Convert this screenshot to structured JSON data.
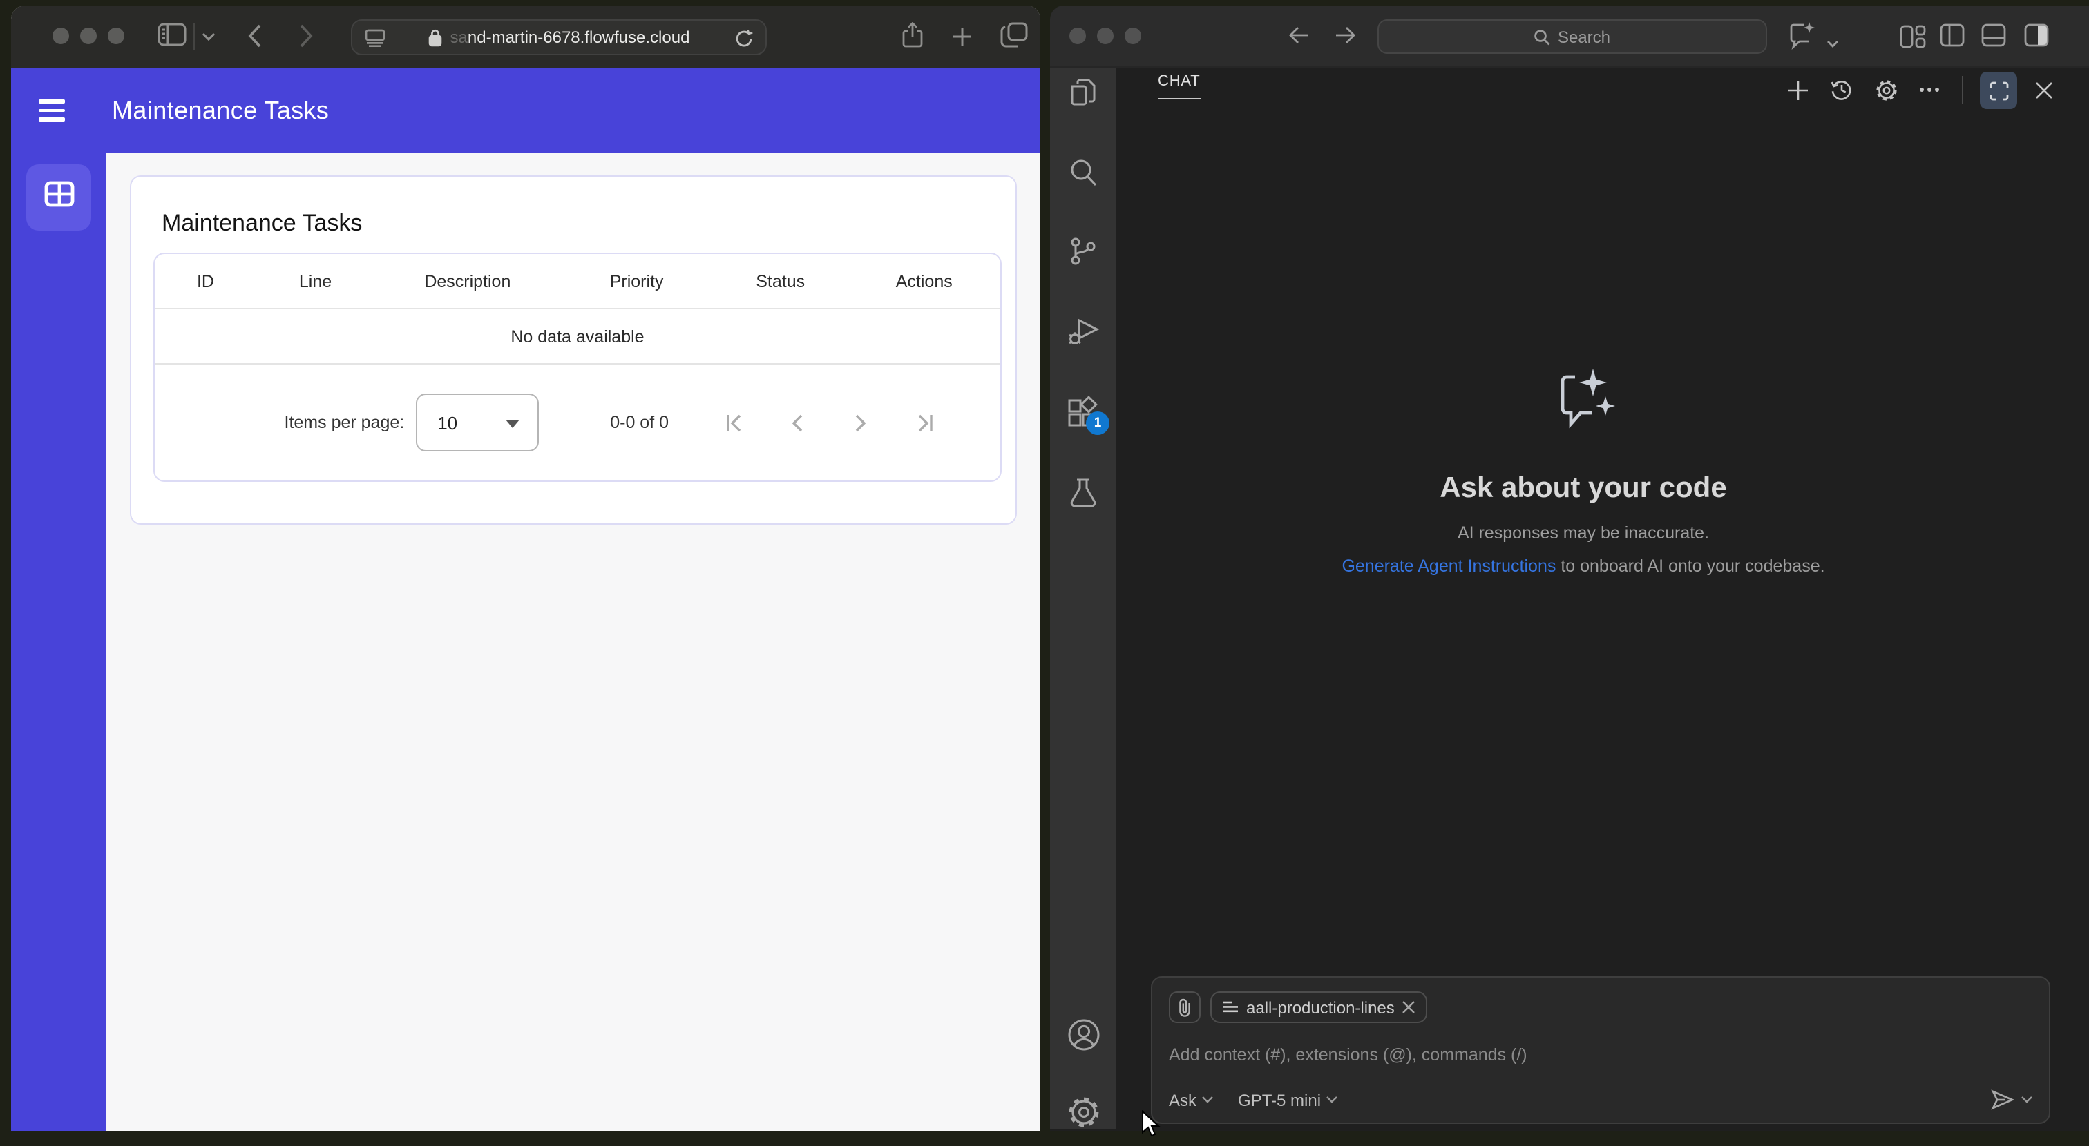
{
  "browser": {
    "url_prefix": "sa",
    "url": "nd-martin-6678.flowfuse.cloud"
  },
  "page": {
    "header_title": "Maintenance Tasks",
    "card_title": "Maintenance Tasks",
    "table": {
      "columns": [
        "ID",
        "Line",
        "Description",
        "Priority",
        "Status",
        "Actions"
      ],
      "empty_message": "No data available"
    },
    "pagination": {
      "items_per_page_label": "Items per page:",
      "items_per_page_value": "10",
      "range_label": "0-0 of 0"
    }
  },
  "vscode": {
    "titlebar": {
      "search_placeholder": "Search"
    },
    "activity_bar": {
      "extensions_badge": "1"
    },
    "chat": {
      "tab_label": "CHAT",
      "empty": {
        "title": "Ask about your code",
        "subtitle": "AI responses may be inaccurate.",
        "link_label": "Generate Agent Instructions",
        "link_suffix": " to onboard AI onto your codebase."
      },
      "input": {
        "context_chip_label": "aall-production-lines",
        "placeholder": "Add context (#), extensions (@), commands (/)",
        "mode_label": "Ask",
        "model_label": "GPT-5 mini"
      }
    }
  },
  "colors": {
    "accent_blue": "#4843d9",
    "badge_blue": "#1078d0",
    "link_blue": "#3574e0"
  }
}
